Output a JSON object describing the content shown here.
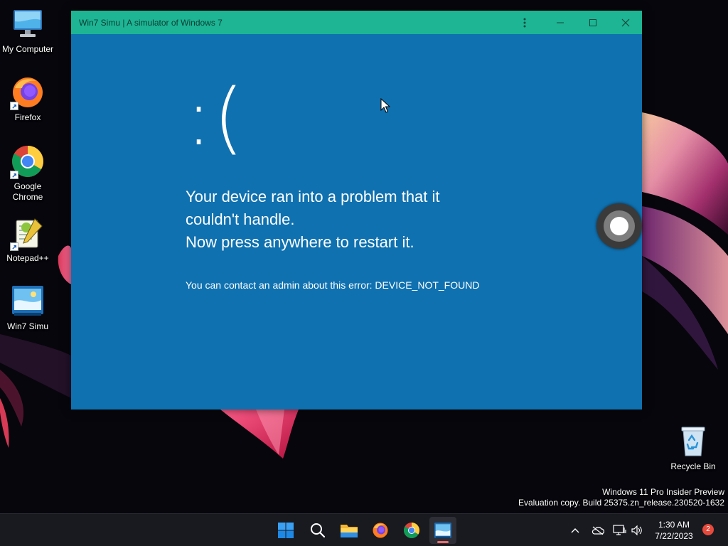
{
  "window": {
    "title": "Win7 Simu | A simulator of Windows 7",
    "colors": {
      "titlebar": "#1db594",
      "content": "#0f71b0"
    }
  },
  "bsod": {
    "face": ":(",
    "message_lines": [
      "Your device ran into a problem that it",
      "couldn't handle.",
      "Now press anywhere to restart it."
    ],
    "contact": "You can contact an admin about this error: DEVICE_NOT_FOUND"
  },
  "desktop": {
    "icons": [
      {
        "label": "My Computer",
        "icon": "monitor-icon"
      },
      {
        "label": "Firefox",
        "icon": "firefox-icon"
      },
      {
        "label": "Google Chrome",
        "icon": "chrome-icon"
      },
      {
        "label": "Notepad++",
        "icon": "notepad-plus-plus-icon"
      },
      {
        "label": "Win7 Simu",
        "icon": "win7-simu-icon"
      },
      {
        "label": "Recycle Bin",
        "icon": "recycle-bin-icon"
      }
    ]
  },
  "watermark": {
    "line1": "Windows 11 Pro Insider Preview",
    "line2": "Evaluation copy. Build 25375.zn_release.230520-1632"
  },
  "taskbar": {
    "apps": [
      "start-icon",
      "search-icon",
      "file-explorer-icon",
      "firefox-icon",
      "chrome-icon",
      "win7-simu-icon"
    ],
    "active_app": "win7-simu-icon",
    "time": "1:30 AM",
    "date": "7/22/2023",
    "notification_count": "2"
  }
}
